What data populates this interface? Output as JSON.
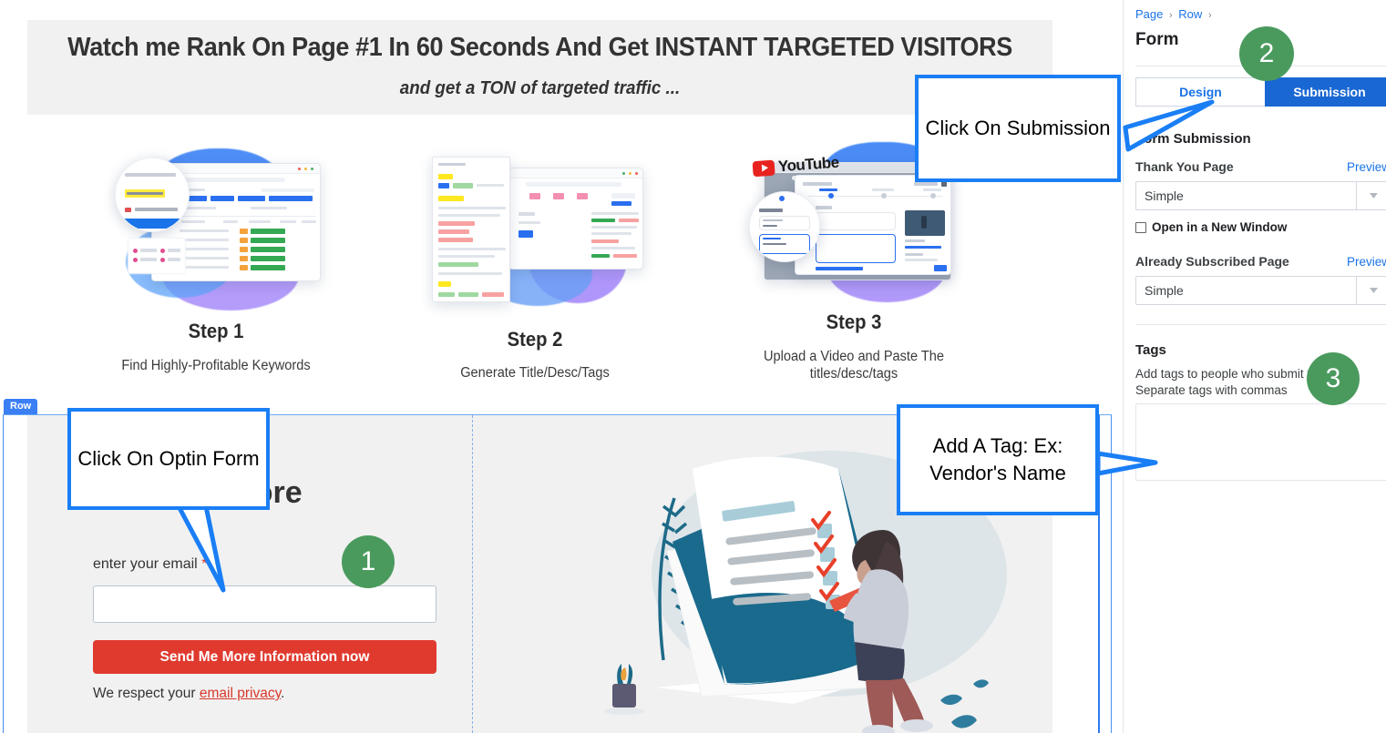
{
  "page": {
    "hero": {
      "title": "Watch me Rank On Page #1 In 60 Seconds And Get INSTANT TARGETED VISITORS",
      "subtitle": "and get a TON of targeted traffic ..."
    },
    "steps": [
      {
        "caption": "Step 1",
        "desc": "Find Highly-Profitable Keywords",
        "image": "keyword-research-mockup"
      },
      {
        "caption": "Step 2",
        "desc": "Generate Title/Desc/Tags",
        "image": "video-details-mockup"
      },
      {
        "caption": "Step 3",
        "desc": "Upload a Video and Paste The titles/desc/tags",
        "image": "youtube-upload-mockup"
      }
    ],
    "optin": {
      "row_badge": "Row",
      "heading": "To Know More",
      "email_label": "enter your email",
      "required_mark": "*",
      "email_value": "",
      "email_placeholder": "",
      "submit_label": "Send Me More Information now",
      "privacy_prefix": "We respect your ",
      "privacy_link": "email privacy",
      "privacy_suffix": ".",
      "illustration": "woman-checking-list-illustration"
    }
  },
  "panel": {
    "breadcrumb": [
      "Page",
      "Row"
    ],
    "breadcrumb_sep": "›",
    "title": "Form",
    "tabs": [
      {
        "label": "Design",
        "active": false
      },
      {
        "label": "Submission",
        "active": true
      }
    ],
    "section_title": "Form Submission",
    "thank_you": {
      "label": "Thank You Page",
      "preview_label": "Preview",
      "value": "Simple",
      "open_new_window_label": "Open in a New Window",
      "open_new_window_checked": false
    },
    "already_subscribed": {
      "label": "Already Subscribed Page",
      "preview_label": "Preview",
      "value": "Simple"
    },
    "tags": {
      "title": "Tags",
      "help_line1": "Add tags to people who submit this form.",
      "help_line2": "Separate tags with commas",
      "value": "",
      "placeholder": ""
    }
  },
  "annotations": {
    "callouts": [
      {
        "text": "Click On Optin Form",
        "target": "optin-email-input"
      },
      {
        "text": "Click On Submission",
        "target": "submission-tab"
      },
      {
        "text": "Add A Tag: Ex: Vendor's Name",
        "target": "tags-textarea"
      }
    ],
    "badges": [
      "1",
      "2",
      "3"
    ]
  },
  "colors": {
    "accent_blue": "#1967d2",
    "callout_blue": "#1a7ef5",
    "badge_green": "#4a9a5e",
    "cta_red": "#e03a2f",
    "band_gray": "#f1f1f1"
  }
}
